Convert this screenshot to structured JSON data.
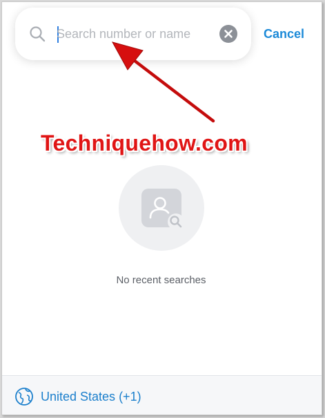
{
  "search": {
    "placeholder": "Search number or name",
    "value": "",
    "cancel_label": "Cancel"
  },
  "watermark": {
    "text": "Techniquehow.com"
  },
  "empty_state": {
    "message": "No recent searches"
  },
  "footer": {
    "country_label": "United States (+1)"
  },
  "colors": {
    "accent": "#1c8ad8",
    "annotation_red": "#e01515",
    "placeholder_gray": "#b3b6bb"
  },
  "icons": {
    "search": "search-icon",
    "clear": "clear-icon",
    "contact_search": "contact-search-icon",
    "globe": "globe-icon"
  }
}
